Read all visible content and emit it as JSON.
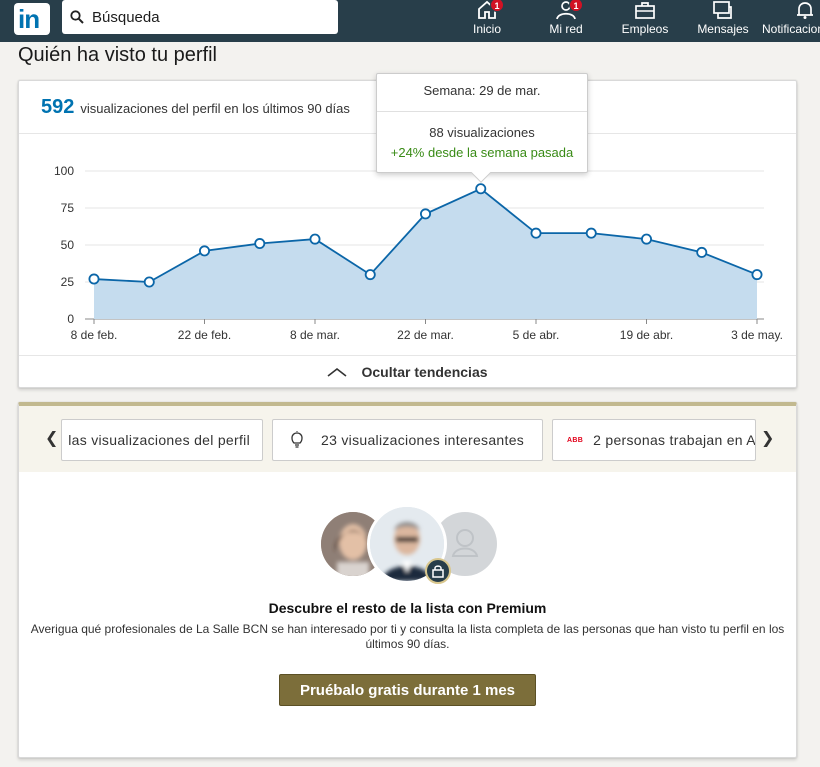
{
  "nav": {
    "logo_text": "in",
    "search_text": "Búsqueda",
    "items": [
      {
        "label": "Inicio",
        "badge": "1"
      },
      {
        "label": "Mi red",
        "badge": "1"
      },
      {
        "label": "Empleos"
      },
      {
        "label": "Mensajes"
      },
      {
        "label": "Notificaciones"
      }
    ]
  },
  "page_title": "Quién ha visto tu perfil",
  "summary": {
    "count": "592",
    "label": "visualizaciones del perfil en los últimos 90 días"
  },
  "tooltip": {
    "week": "Semana: 29 de mar.",
    "views": "88 visualizaciones",
    "change": "+24% desde la semana pasada"
  },
  "toggle_label": "Ocultar tendencias",
  "chart_data": {
    "type": "area",
    "x": [
      "8 de feb.",
      "15 de feb.",
      "22 de feb.",
      "1 de mar.",
      "8 de mar.",
      "15 de mar.",
      "22 de mar.",
      "29 de mar.",
      "5 de abr.",
      "12 de abr.",
      "19 de abr.",
      "26 de abr.",
      "3 de may."
    ],
    "values": [
      27,
      25,
      46,
      51,
      54,
      30,
      71,
      88,
      58,
      58,
      54,
      45,
      30
    ],
    "tick_labels": [
      "8 de feb.",
      "22 de feb.",
      "8 de mar.",
      "22 de mar.",
      "5 de abr.",
      "19 de abr.",
      "3 de may."
    ],
    "y_ticks": [
      0,
      25,
      50,
      75,
      100
    ],
    "ylim": [
      0,
      100
    ],
    "grid": true,
    "colors": {
      "line": "#0b66a8",
      "fill": "#c5dcee"
    }
  },
  "premium": {
    "tabs": [
      {
        "label": "las visualizaciones del perfil"
      },
      {
        "label": "23 visualizaciones interesantes"
      },
      {
        "label": "2 personas trabajan en A"
      }
    ],
    "company_logo_text": "ABB",
    "title": "Descubre el resto de la lista con Premium",
    "description": "Averigua qué profesionales de La Salle BCN se han interesado por ti y consulta la lista completa de las personas que han visto tu perfil en los últimos 90 días.",
    "cta": "Pruébalo gratis durante 1 mes",
    "accent": "#7c6e3a"
  }
}
